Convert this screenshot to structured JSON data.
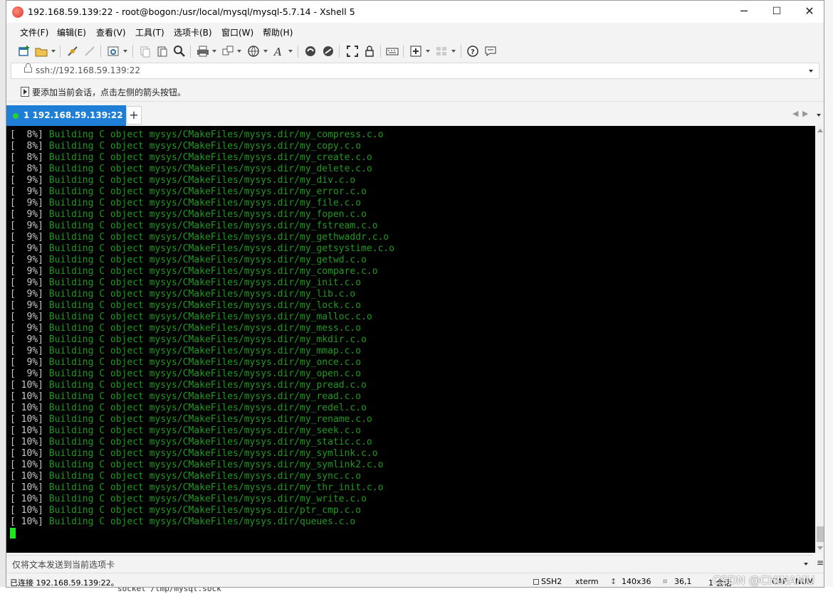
{
  "window": {
    "title": "192.168.59.139:22 - root@bogon:/usr/local/mysql/mysql-5.7.14 - Xshell 5",
    "minimize": "─",
    "maximize": "☐",
    "close": "✕"
  },
  "menu": [
    "文件(F)",
    "编辑(E)",
    "查看(V)",
    "工具(T)",
    "选项卡(B)",
    "窗口(W)",
    "帮助(H)"
  ],
  "address": {
    "value": "ssh://192.168.59.139:22"
  },
  "hint": {
    "text": "要添加当前会话，点击左侧的箭头按钮。"
  },
  "tabs": [
    {
      "label": "1 192.168.59.139:22",
      "active": true,
      "status_color": "#27d12b"
    }
  ],
  "tab_add": "+",
  "tab_nav": {
    "prev": "◀",
    "next": "▶"
  },
  "terminal": {
    "lines": [
      {
        "pct": "[  8%]",
        "msg": "Building C object mysys/CMakeFiles/mysys.dir/my_compress.c.o"
      },
      {
        "pct": "[  8%]",
        "msg": "Building C object mysys/CMakeFiles/mysys.dir/my_copy.c.o"
      },
      {
        "pct": "[  8%]",
        "msg": "Building C object mysys/CMakeFiles/mysys.dir/my_create.c.o"
      },
      {
        "pct": "[  8%]",
        "msg": "Building C object mysys/CMakeFiles/mysys.dir/my_delete.c.o"
      },
      {
        "pct": "[  9%]",
        "msg": "Building C object mysys/CMakeFiles/mysys.dir/my_div.c.o"
      },
      {
        "pct": "[  9%]",
        "msg": "Building C object mysys/CMakeFiles/mysys.dir/my_error.c.o"
      },
      {
        "pct": "[  9%]",
        "msg": "Building C object mysys/CMakeFiles/mysys.dir/my_file.c.o"
      },
      {
        "pct": "[  9%]",
        "msg": "Building C object mysys/CMakeFiles/mysys.dir/my_fopen.c.o"
      },
      {
        "pct": "[  9%]",
        "msg": "Building C object mysys/CMakeFiles/mysys.dir/my_fstream.c.o"
      },
      {
        "pct": "[  9%]",
        "msg": "Building C object mysys/CMakeFiles/mysys.dir/my_gethwaddr.c.o"
      },
      {
        "pct": "[  9%]",
        "msg": "Building C object mysys/CMakeFiles/mysys.dir/my_getsystime.c.o"
      },
      {
        "pct": "[  9%]",
        "msg": "Building C object mysys/CMakeFiles/mysys.dir/my_getwd.c.o"
      },
      {
        "pct": "[  9%]",
        "msg": "Building C object mysys/CMakeFiles/mysys.dir/my_compare.c.o"
      },
      {
        "pct": "[  9%]",
        "msg": "Building C object mysys/CMakeFiles/mysys.dir/my_init.c.o"
      },
      {
        "pct": "[  9%]",
        "msg": "Building C object mysys/CMakeFiles/mysys.dir/my_lib.c.o"
      },
      {
        "pct": "[  9%]",
        "msg": "Building C object mysys/CMakeFiles/mysys.dir/my_lock.c.o"
      },
      {
        "pct": "[  9%]",
        "msg": "Building C object mysys/CMakeFiles/mysys.dir/my_malloc.c.o"
      },
      {
        "pct": "[  9%]",
        "msg": "Building C object mysys/CMakeFiles/mysys.dir/my_mess.c.o"
      },
      {
        "pct": "[  9%]",
        "msg": "Building C object mysys/CMakeFiles/mysys.dir/my_mkdir.c.o"
      },
      {
        "pct": "[  9%]",
        "msg": "Building C object mysys/CMakeFiles/mysys.dir/my_mmap.c.o"
      },
      {
        "pct": "[  9%]",
        "msg": "Building C object mysys/CMakeFiles/mysys.dir/my_once.c.o"
      },
      {
        "pct": "[  9%]",
        "msg": "Building C object mysys/CMakeFiles/mysys.dir/my_open.c.o"
      },
      {
        "pct": "[ 10%]",
        "msg": "Building C object mysys/CMakeFiles/mysys.dir/my_pread.c.o"
      },
      {
        "pct": "[ 10%]",
        "msg": "Building C object mysys/CMakeFiles/mysys.dir/my_read.c.o"
      },
      {
        "pct": "[ 10%]",
        "msg": "Building C object mysys/CMakeFiles/mysys.dir/my_redel.c.o"
      },
      {
        "pct": "[ 10%]",
        "msg": "Building C object mysys/CMakeFiles/mysys.dir/my_rename.c.o"
      },
      {
        "pct": "[ 10%]",
        "msg": "Building C object mysys/CMakeFiles/mysys.dir/my_seek.c.o"
      },
      {
        "pct": "[ 10%]",
        "msg": "Building C object mysys/CMakeFiles/mysys.dir/my_static.c.o"
      },
      {
        "pct": "[ 10%]",
        "msg": "Building C object mysys/CMakeFiles/mysys.dir/my_symlink.c.o"
      },
      {
        "pct": "[ 10%]",
        "msg": "Building C object mysys/CMakeFiles/mysys.dir/my_symlink2.c.o"
      },
      {
        "pct": "[ 10%]",
        "msg": "Building C object mysys/CMakeFiles/mysys.dir/my_sync.c.o"
      },
      {
        "pct": "[ 10%]",
        "msg": "Building C object mysys/CMakeFiles/mysys.dir/my_thr_init.c.o"
      },
      {
        "pct": "[ 10%]",
        "msg": "Building C object mysys/CMakeFiles/mysys.dir/my_write.c.o"
      },
      {
        "pct": "[ 10%]",
        "msg": "Building C object mysys/CMakeFiles/mysys.dir/ptr_cmp.c.o"
      },
      {
        "pct": "[ 10%]",
        "msg": "Building C object mysys/CMakeFiles/mysys.dir/queues.c.o"
      }
    ],
    "pct_color": "#c8c8c8",
    "msg_color": "#1e9a1e",
    "cursor_color": "#1fe61f"
  },
  "send_bar": {
    "placeholder": "仅将文本发送到当前选项卡",
    "menu_glyph": "≡"
  },
  "status": {
    "connection": "已连接 192.168.59.139:22。",
    "protocol": "SSH2",
    "terminal_type": "xterm",
    "size": "140x36",
    "cursor_pos": "36,1",
    "sessions": "1 会话",
    "caps": "CAP",
    "num": "NUM"
  },
  "watermark": "CSDN @CHINAMU",
  "background": {
    "bottom_text": "socket      /tmp/mysql.sock"
  }
}
